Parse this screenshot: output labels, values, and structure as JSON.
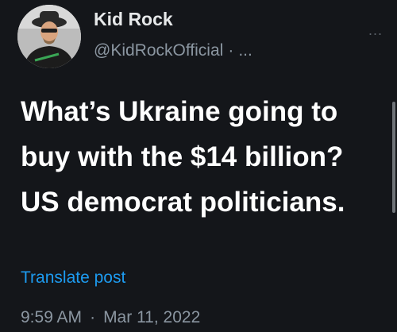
{
  "author": {
    "display_name": "Kid Rock",
    "handle": "@KidRockOfficial",
    "separator": "·",
    "ellipsis": "..."
  },
  "avatar": {
    "icon": "profile-photo"
  },
  "more_menu": {
    "label": "..."
  },
  "tweet": {
    "text": "What’s Ukraine going to buy with the $14 billion? US democrat politicians."
  },
  "translate": {
    "label": "Translate post"
  },
  "meta": {
    "time": "9:59 AM",
    "separator": "·",
    "date": "Mar 11, 2022"
  },
  "colors": {
    "background": "#14161a",
    "text_primary": "#e7e9ea",
    "text_secondary": "#8b96a1",
    "link": "#1d9bf0"
  }
}
